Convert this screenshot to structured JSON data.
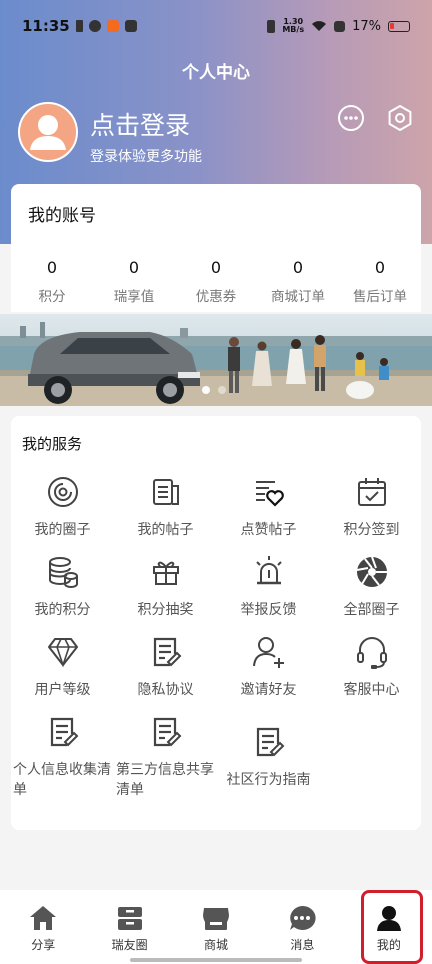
{
  "status_bar": {
    "time": "11:35",
    "net_speed_value": "1.30",
    "net_speed_unit": "MB/s",
    "battery": "17%"
  },
  "header": {
    "title": "个人中心",
    "login_title": "点击登录",
    "login_subtitle": "登录体验更多功能"
  },
  "account": {
    "title": "我的账号",
    "stats": [
      {
        "value": "0",
        "label": "积分"
      },
      {
        "value": "0",
        "label": "瑞享值"
      },
      {
        "value": "0",
        "label": "优惠券"
      },
      {
        "value": "0",
        "label": "商城订单"
      },
      {
        "value": "0",
        "label": "售后订单"
      }
    ]
  },
  "banner": {
    "plate": "",
    "slides": 2,
    "active_slide": 1
  },
  "services": {
    "title": "我的服务",
    "items": [
      {
        "label": "我的圈子",
        "icon": "circle-icon"
      },
      {
        "label": "我的帖子",
        "icon": "posts-icon"
      },
      {
        "label": "点赞帖子",
        "icon": "liked-posts-icon"
      },
      {
        "label": "积分签到",
        "icon": "calendar-check-icon"
      },
      {
        "label": "我的积分",
        "icon": "coins-icon"
      },
      {
        "label": "积分抽奖",
        "icon": "gift-icon"
      },
      {
        "label": "举报反馈",
        "icon": "alarm-light-icon"
      },
      {
        "label": "全部圈子",
        "icon": "aperture-icon"
      },
      {
        "label": "用户等级",
        "icon": "diamond-icon"
      },
      {
        "label": "隐私协议",
        "icon": "document-pen-icon"
      },
      {
        "label": "邀请好友",
        "icon": "add-user-icon"
      },
      {
        "label": "客服中心",
        "icon": "headset-icon"
      },
      {
        "label": "个人信息收集清单",
        "icon": "document-pen-icon"
      },
      {
        "label": "第三方信息共享清单",
        "icon": "document-pen-icon"
      },
      {
        "label": "社区行为指南",
        "icon": "document-pen-icon"
      }
    ]
  },
  "bottom_nav": {
    "items": [
      {
        "label": "分享",
        "icon": "home-icon"
      },
      {
        "label": "瑞友圈",
        "icon": "drawer-icon"
      },
      {
        "label": "商城",
        "icon": "store-icon"
      },
      {
        "label": "消息",
        "icon": "chat-icon"
      },
      {
        "label": "我的",
        "icon": "person-icon"
      }
    ],
    "active_index": 4
  },
  "colors": {
    "accent_red": "#d01f2a",
    "avatar": "#f4a583",
    "header_gradient_start": "#6b8ccc",
    "header_gradient_end": "#cda4aa"
  }
}
